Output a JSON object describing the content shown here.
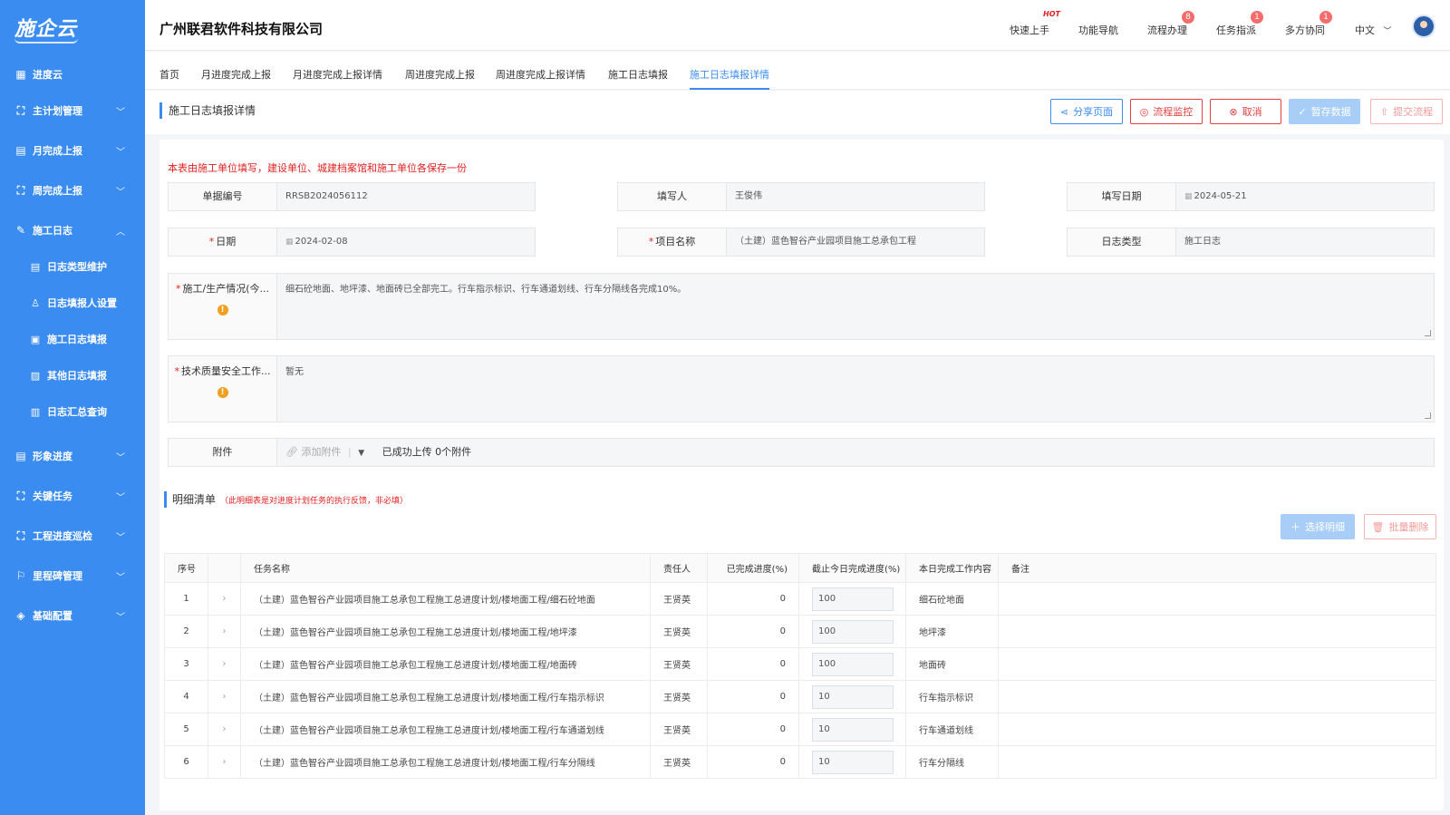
{
  "sidebar": {
    "logo": "施企云",
    "items": [
      {
        "label": "进度云",
        "icon": "grid-icon"
      },
      {
        "label": "主计划管理",
        "icon": "hierarchy-icon"
      },
      {
        "label": "月完成上报",
        "icon": "clipboard-icon"
      },
      {
        "label": "周完成上报",
        "icon": "hierarchy-icon"
      },
      {
        "label": "施工日志",
        "icon": "log-icon"
      },
      {
        "label": "日志类型维护",
        "icon": "list-doc-icon"
      },
      {
        "label": "日志填报人设置",
        "icon": "user-icon"
      },
      {
        "label": "施工日志填报",
        "icon": "doc-icon"
      },
      {
        "label": "其他日志填报",
        "icon": "image-doc-icon"
      },
      {
        "label": "日志汇总查询",
        "icon": "search-doc-icon"
      },
      {
        "label": "形象进度",
        "icon": "stack-icon"
      },
      {
        "label": "关键任务",
        "icon": "hierarchy-icon"
      },
      {
        "label": "工程进度巡检",
        "icon": "hierarchy-icon"
      },
      {
        "label": "里程碑管理",
        "icon": "milestone-icon"
      },
      {
        "label": "基础配置",
        "icon": "layers-icon"
      }
    ]
  },
  "header": {
    "company": "广州联君软件科技有限公司",
    "quick_start": "快速上手",
    "hot_tag": "HOT",
    "nav": "功能导航",
    "process": "流程办理",
    "process_badge": "8",
    "task": "任务指派",
    "task_badge": "1",
    "collab": "多方协同",
    "collab_badge": "1",
    "lang": "中文"
  },
  "tabs": [
    "首页",
    "月进度完成上报",
    "月进度完成上报详情",
    "周进度完成上报",
    "周进度完成上报详情",
    "施工日志填报",
    "施工日志填报详情"
  ],
  "page": {
    "title": "施工日志填报详情",
    "actions": {
      "share": "分享页面",
      "monitor": "流程监控",
      "cancel": "取消",
      "save": "暂存数据",
      "submit": "提交流程"
    }
  },
  "form": {
    "note": "本表由施工单位填写，建设单位、城建档案馆和施工单位各保存一份",
    "doc_no_label": "单据编号",
    "doc_no": "RRSB2024056112",
    "filler_label": "填写人",
    "filler": "王俊伟",
    "fill_date_label": "填写日期",
    "fill_date": "2024-05-21",
    "date_label": "日期",
    "date": "2024-02-08",
    "project_label": "项目名称",
    "project": "（土建）蓝色智谷产业园项目施工总承包工程",
    "log_type_label": "日志类型",
    "log_type": "施工日志",
    "production_label": "施工/生产情况(今...",
    "production": "细石砼地面、地坪漆、地面砖已全部完工。行车指示标识、行车通道划线、行车分隔线各完成10%。",
    "quality_label": "技术质量安全工作...",
    "quality": "暂无",
    "attach_label": "附件",
    "attach_add": "添加附件",
    "attach_status": "已成功上传 0个附件"
  },
  "detail": {
    "title": "明细清单",
    "note": "（此明细表是对进度计划任务的执行反馈，非必填）",
    "pick": "选择明细",
    "batch_delete": "批量删除",
    "columns": [
      "序号",
      "",
      "任务名称",
      "责任人",
      "已完成进度(%)",
      "截止今日完成进度(%)",
      "本日完成工作内容",
      "备注"
    ],
    "rows": [
      {
        "no": "1",
        "task": "（土建）蓝色智谷产业园项目施工总承包工程施工总进度计划/楼地面工程/细石砼地面",
        "owner": "王贤英",
        "done": "0",
        "progress": "100",
        "content": "细石砼地面",
        "remark": ""
      },
      {
        "no": "2",
        "task": "（土建）蓝色智谷产业园项目施工总承包工程施工总进度计划/楼地面工程/地坪漆",
        "owner": "王贤英",
        "done": "0",
        "progress": "100",
        "content": "地坪漆",
        "remark": ""
      },
      {
        "no": "3",
        "task": "（土建）蓝色智谷产业园项目施工总承包工程施工总进度计划/楼地面工程/地面砖",
        "owner": "王贤英",
        "done": "0",
        "progress": "100",
        "content": "地面砖",
        "remark": ""
      },
      {
        "no": "4",
        "task": "（土建）蓝色智谷产业园项目施工总承包工程施工总进度计划/楼地面工程/行车指示标识",
        "owner": "王贤英",
        "done": "0",
        "progress": "10",
        "content": "行车指示标识",
        "remark": ""
      },
      {
        "no": "5",
        "task": "（土建）蓝色智谷产业园项目施工总承包工程施工总进度计划/楼地面工程/行车通道划线",
        "owner": "王贤英",
        "done": "0",
        "progress": "10",
        "content": "行车通道划线",
        "remark": ""
      },
      {
        "no": "6",
        "task": "（土建）蓝色智谷产业园项目施工总承包工程施工总进度计划/楼地面工程/行车分隔线",
        "owner": "王贤英",
        "done": "0",
        "progress": "10",
        "content": "行车分隔线",
        "remark": ""
      }
    ]
  },
  "colors": {
    "primary": "#3a8cf0",
    "danger": "#e02020",
    "warning": "#f0a020"
  }
}
